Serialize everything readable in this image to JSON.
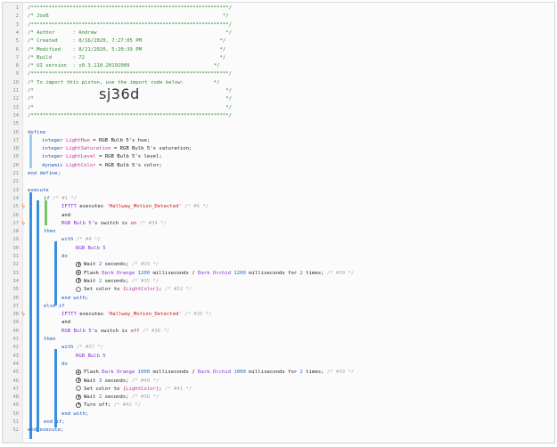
{
  "header": {
    "border": "/******************************************************************/",
    "title": "/* Jooß                                                          */",
    "author": "/* Author      : Andrew                                           */",
    "created": "/* Created     : 8/16/2020, 7:27:05 PM                          */",
    "modified": "/* Modified    : 8/21/2020, 5:20:39 PM                          */",
    "build": "/* Build       : 72                                             */",
    "ui_version": "/* UI version  : v0.3.110.20191009                            */",
    "import_hint": "/* To import this piston, use the import code below:          */",
    "blank": "/*                                                                */",
    "import_code": "sj36d"
  },
  "line_numbers": [
    "1",
    "2",
    "3",
    "4",
    "5",
    "6",
    "7",
    "8",
    "9",
    "10",
    "11",
    "12",
    "13",
    "14",
    "15",
    "16",
    "17",
    "18",
    "19",
    "20",
    "21",
    "22",
    "23",
    "24",
    "25",
    "26",
    "27",
    "28",
    "29",
    "30",
    "31",
    "32",
    "33",
    "34",
    "35",
    "36",
    "37",
    "38",
    "39",
    "40",
    "41",
    "42",
    "43",
    "44",
    "45",
    "46",
    "47",
    "48",
    "49",
    "50",
    "51",
    "52"
  ],
  "code": {
    "define": "define",
    "v1": {
      "type": "integer",
      "name": "LightHue",
      "rest": " = RGB Bulb 5's hue;"
    },
    "v2": {
      "type": "integer",
      "name": "LightSaturation",
      "rest": " = RGB Bulb 5's saturation;"
    },
    "v3": {
      "type": "integer",
      "name": "LightLevel",
      "rest": " = RGB Bulb 5's level;"
    },
    "v4": {
      "type": "dynamic",
      "name": "LightColor",
      "rest": " = RGB Bulb 5's color;"
    },
    "end_define": "end define;",
    "execute": "execute",
    "if1": "if",
    "if1_cmt": "/* #1 */",
    "c1a": "IFTTT",
    "c1b": " executes ",
    "c1c": "'Hallway_Motion_Detected'",
    "c1cmt": "/* #6 */",
    "and1": "and",
    "c2a": "RGB Bulb 5",
    "c2b": "'s switch is ",
    "c2c": "on",
    "c2cmt": "/* #34 */",
    "then1": "then",
    "with1": "with",
    "with1_cmt": "/* #4 */",
    "dev1": "RGB Bulb 5",
    "do1": "do",
    "s1a": "Wait ",
    "s1b": "2",
    "s1c": " seconds;",
    "s1cmt": "/* #29 */",
    "s2a": "Flash ",
    "s2b": "Dark Orange",
    "s2c": "1200",
    "s2d": " milliseconds / ",
    "s2e": "Dark Orchid",
    "s2f": "1200",
    "s2g": " milliseconds for ",
    "s2h": "2",
    "s2i": " times;",
    "s2cmt": "/* #30 */",
    "s3a": "Wait ",
    "s3b": "2",
    "s3c": " seconds;",
    "s3cmt": "/* #35 */",
    "s4a": "Set color to ",
    "s4b": "{LightColor}",
    "s4c": ";",
    "s4cmt": "/* #32 */",
    "endwith1": "end with;",
    "elseif": "else if",
    "c3a": "IFTTT",
    "c3b": " executes ",
    "c3c": "'Hallway_Motion_Detected'",
    "c3cmt": "/* #35 */",
    "and2": "and",
    "c4a": "RGB Bulb 5",
    "c4b": "'s switch is ",
    "c4c": "off",
    "c4cmt": "/* #36 */",
    "then2": "then",
    "with2": "with",
    "with2_cmt": "/* #37 */",
    "dev2": "RGB Bulb 5",
    "do2": "do",
    "t1a": "Flash ",
    "t1b": "Dark Orange",
    "t1c": "1000",
    "t1d": " milliseconds / ",
    "t1e": "Dark Orchid",
    "t1f": "1000",
    "t1g": " milliseconds for ",
    "t1h": "2",
    "t1i": " times;",
    "t1cmt": "/* #39 */",
    "t2a": "Wait ",
    "t2b": "3",
    "t2c": " seconds;",
    "t2cmt": "/* #40 */",
    "t3a": "Set color to ",
    "t3b": "{LightColor}",
    "t3c": ";",
    "t3cmt": "/* #41 */",
    "t4a": "Wait ",
    "t4b": "2",
    "t4c": " seconds;",
    "t4cmt": "/* #38 */",
    "t5a": "Turn off;",
    "t5cmt": "/* #42 */",
    "endwith2": "end with;",
    "endif": "end if;",
    "endexecute": "end execute;"
  },
  "colors": {
    "keyword": "#1f57b8",
    "variable": "#c0339a",
    "device": "#8a2be2",
    "string": "#c41a1a",
    "comment": "#a8a8a8",
    "header": "#2e8b2e",
    "trigger": "#e07a24"
  }
}
